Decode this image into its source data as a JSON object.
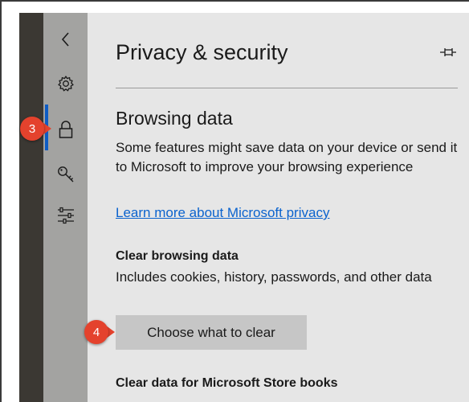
{
  "panel": {
    "title": "Privacy & security",
    "pin_icon": "pin-icon"
  },
  "sidebar": {
    "items": [
      {
        "icon": "back-chevron-icon",
        "glyph": "‹"
      },
      {
        "icon": "gear-icon"
      },
      {
        "icon": "lock-icon",
        "active": true
      },
      {
        "icon": "key-icon"
      },
      {
        "icon": "sliders-icon"
      }
    ],
    "active_color": "#0e5cc4"
  },
  "browsing": {
    "heading": "Browsing data",
    "description": "Some features might save data on your device or send it to Microsoft to improve your browsing experience",
    "link": "Learn more about Microsoft privacy"
  },
  "clear_browsing": {
    "heading": "Clear browsing data",
    "description": "Includes cookies, history, passwords, and other data",
    "button": "Choose what to clear"
  },
  "store_books": {
    "heading": "Clear data for Microsoft Store books"
  },
  "callouts": {
    "step_sidebar": "3",
    "step_button": "4",
    "color": "#e4422d"
  }
}
